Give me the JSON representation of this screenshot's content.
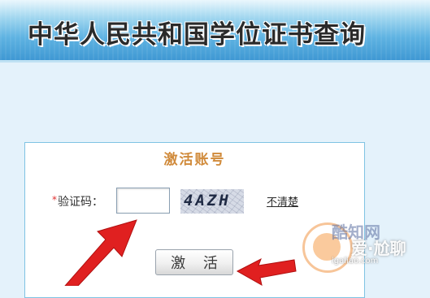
{
  "header": {
    "title": "中华人民共和国学位证书查询"
  },
  "form": {
    "title": "激活账号",
    "required_mark": "*",
    "captcha_label": "验证码：",
    "captcha_value": "",
    "captcha_text": "4AZH",
    "refresh_link": "不清楚",
    "submit_label": "激 活"
  },
  "watermark": {
    "brand": "酷知网",
    "mark": "爱·尬聊",
    "url": "igaliao.com"
  },
  "colors": {
    "banner_blue": "#3f98d3",
    "panel_border": "#7fc3e3",
    "title_orange": "#d08a3a",
    "arrow_red": "#e02020"
  }
}
